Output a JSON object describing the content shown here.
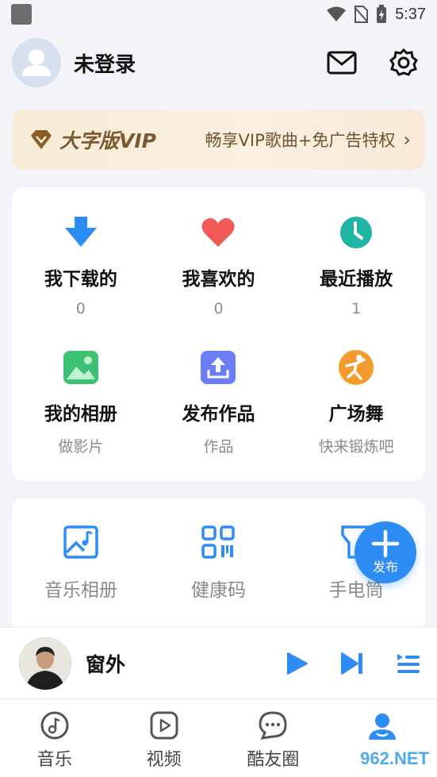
{
  "status_bar": {
    "time": "5:37"
  },
  "profile": {
    "name": "未登录"
  },
  "vip": {
    "title": "大字版VIP",
    "desc": "畅享VIP歌曲+免广告特权",
    "arrow": "›"
  },
  "main_grid": [
    {
      "label": "我下载的",
      "sub": "0",
      "icon": "download-icon",
      "color": "#2e8cf5"
    },
    {
      "label": "我喜欢的",
      "sub": "0",
      "icon": "heart-icon",
      "color": "#f25a57"
    },
    {
      "label": "最近播放",
      "sub": "1",
      "icon": "clock-icon",
      "color": "#1fb5a5"
    },
    {
      "label": "我的相册",
      "sub": "做影片",
      "icon": "image-icon",
      "color": "#3cc272"
    },
    {
      "label": "发布作品",
      "sub": "作品",
      "icon": "upload-icon",
      "color": "#6b7ef5"
    },
    {
      "label": "广场舞",
      "sub": "快来锻炼吧",
      "icon": "dance-icon",
      "color": "#f59b2e"
    }
  ],
  "tools": [
    {
      "label": "音乐相册",
      "icon": "music-album-icon"
    },
    {
      "label": "健康码",
      "icon": "qr-code-icon"
    },
    {
      "label": "手电筒",
      "icon": "flashlight-icon"
    }
  ],
  "fab": {
    "label": "发布"
  },
  "player": {
    "title": "窗外"
  },
  "tabs": [
    {
      "label": "音乐",
      "icon": "music-note-icon"
    },
    {
      "label": "视频",
      "icon": "video-play-icon"
    },
    {
      "label": "酷友圈",
      "icon": "chat-bubble-icon"
    },
    {
      "label": "",
      "icon": "user-icon"
    }
  ],
  "watermark": "962.NET",
  "colors": {
    "accent": "#2e8cf5",
    "vip_text": "#7a5a2e"
  }
}
